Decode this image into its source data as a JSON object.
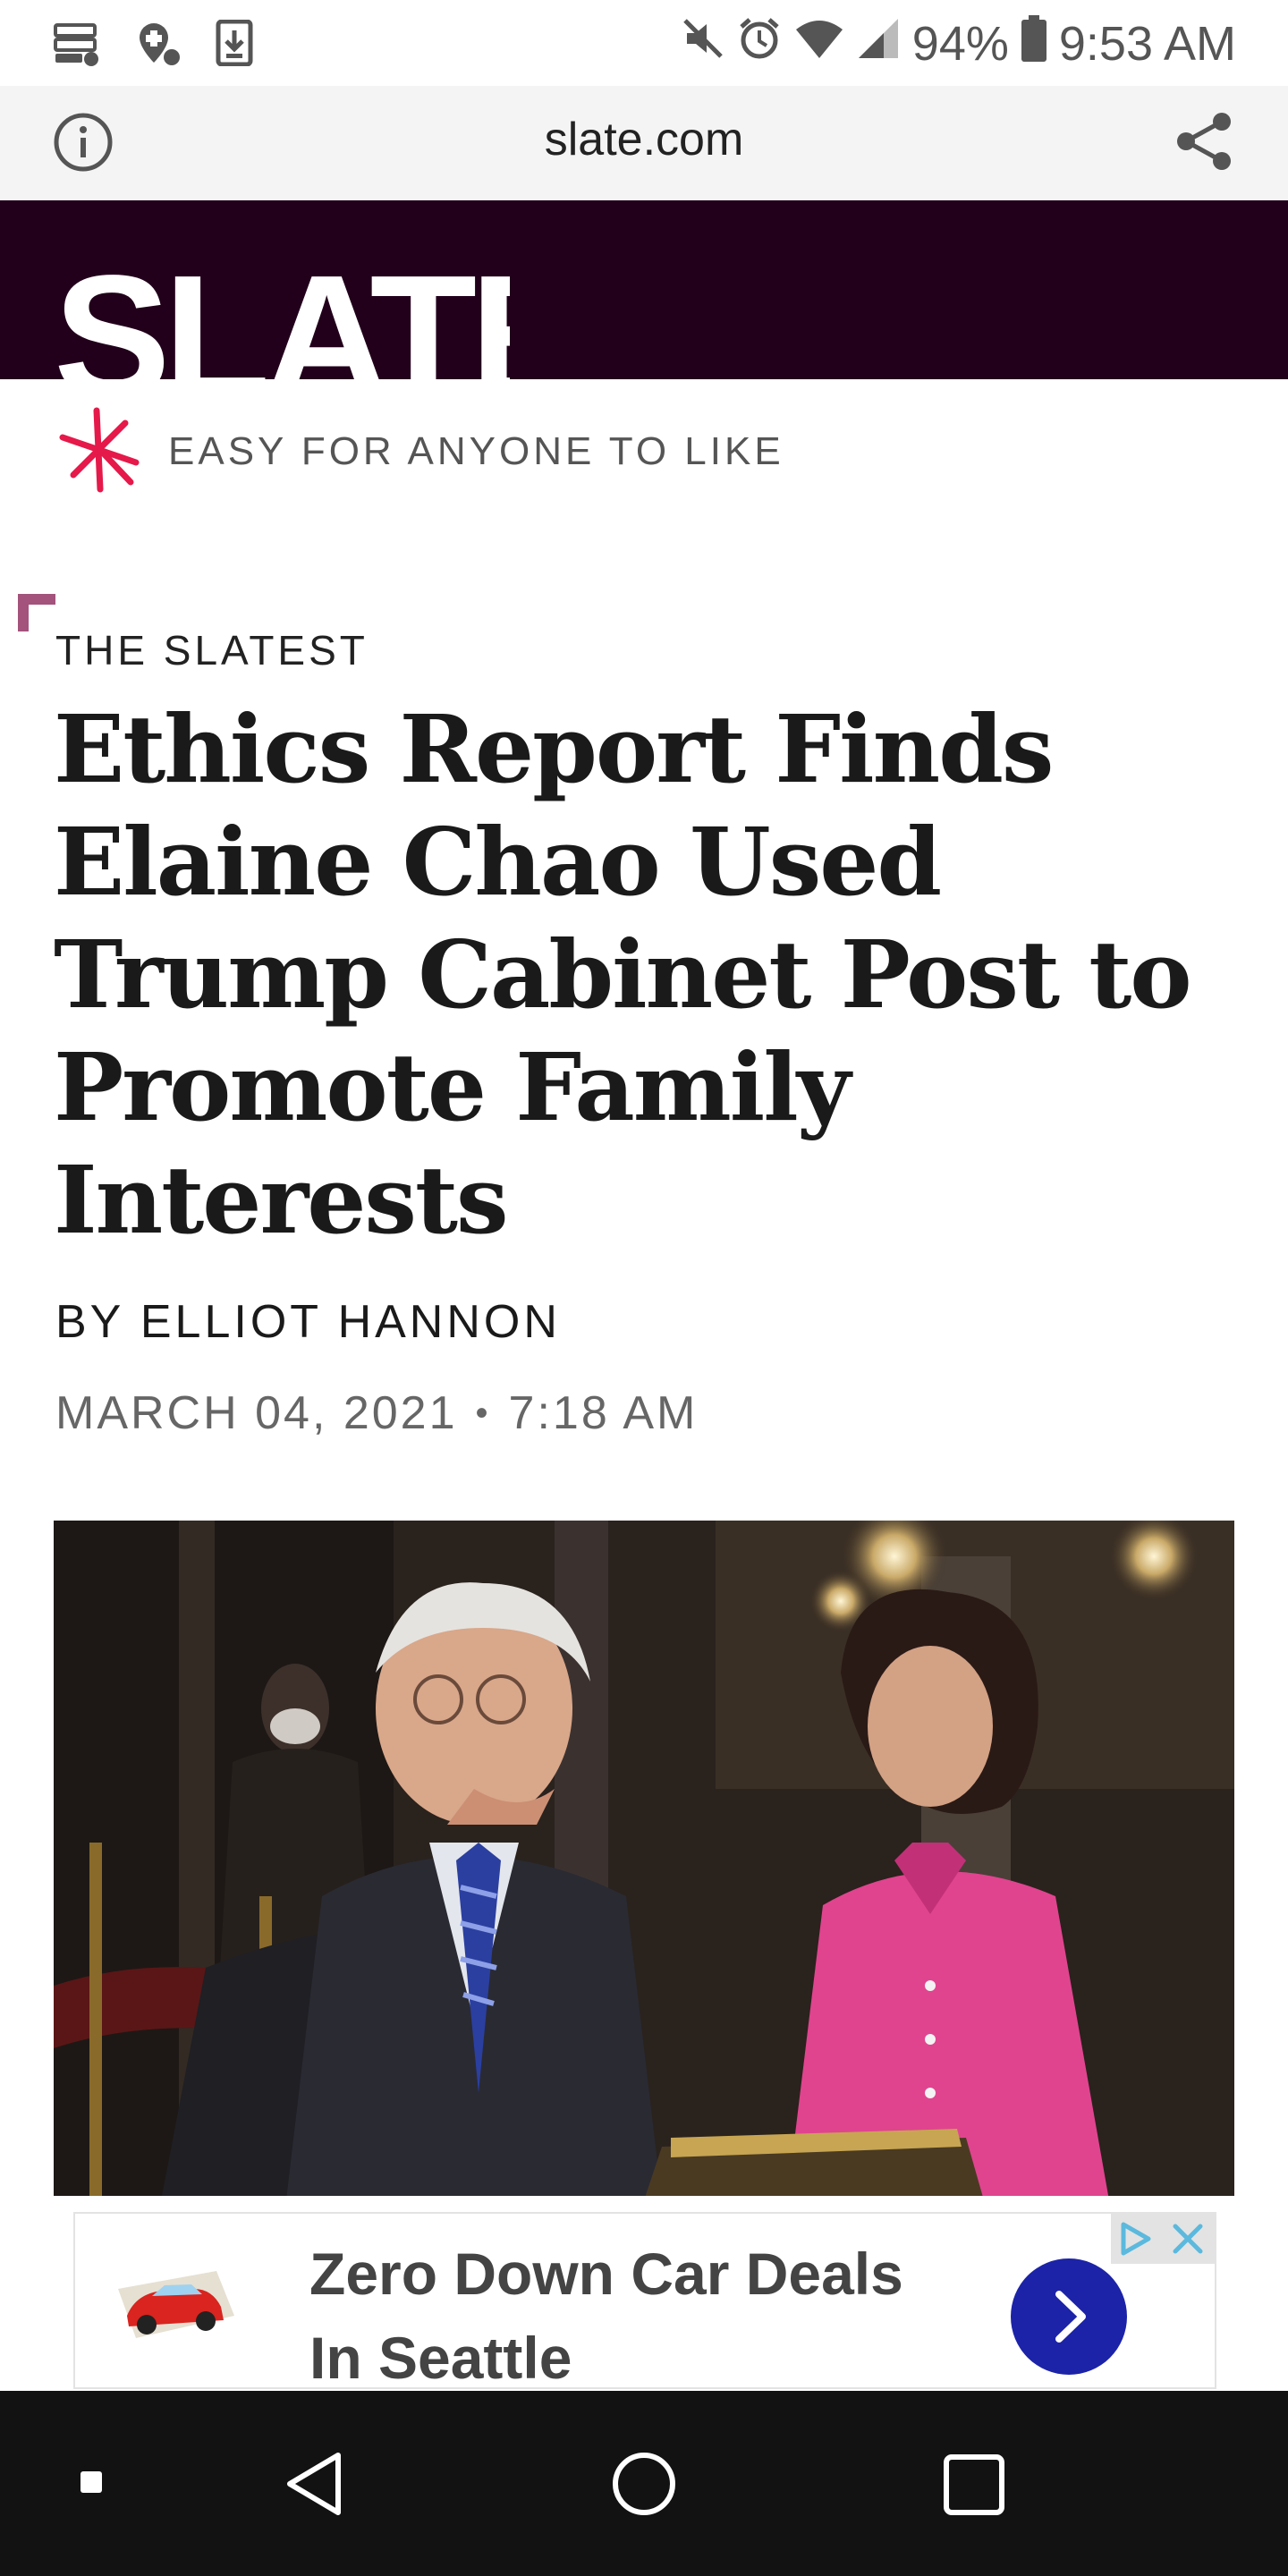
{
  "status_bar": {
    "battery": "94%",
    "time": "9:53 AM",
    "icons": [
      "storage-icon",
      "location-add-icon",
      "download-icon",
      "mute-icon",
      "alarm-icon",
      "wifi-icon",
      "signal-icon",
      "battery-icon"
    ]
  },
  "browser": {
    "url": "slate.com",
    "icons": [
      "info-icon",
      "share-icon"
    ]
  },
  "masthead": {
    "logo_text": "SLATE",
    "bg_color": "#22001b"
  },
  "section": {
    "label": "EASY FOR ANYONE TO LIKE",
    "icon": "slate-star-icon",
    "icon_color": "#e5194a"
  },
  "article": {
    "kicker": "THE SLATEST",
    "headline": "Ethics Report Finds Elaine Chao Used Trump Cabinet Post to Promote Family Interests",
    "byline": "BY ELLIOT HANNON",
    "date": "MARCH 04, 2021",
    "time": "7:18 AM"
  },
  "ad": {
    "line1": "Zero Down Car Deals",
    "line2": "In Seattle",
    "go_color": "#1c23a8",
    "icons": [
      "car-thumbnail-icon",
      "chevron-right-icon",
      "adchoices-icon",
      "close-icon"
    ]
  },
  "nav_bar": {
    "icons": [
      "menu-dot-icon",
      "back-icon",
      "home-icon",
      "recents-icon"
    ]
  }
}
